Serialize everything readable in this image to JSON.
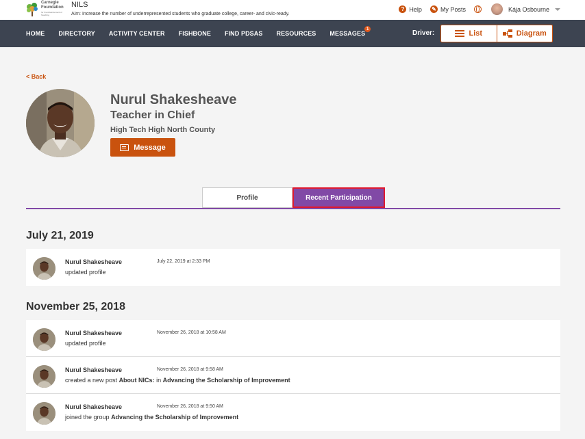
{
  "header": {
    "logo_line1": "Carnegie",
    "logo_line2": "Foundation",
    "logo_sub": "for the Advancement of Teaching",
    "app_name": "NILS",
    "aim": "Aim:  Increase the number of underrepresented students who graduate college, career- and civic-ready.",
    "help": "Help",
    "my_posts": "My Posts",
    "user_name": "Kája Osbourne"
  },
  "nav": {
    "items": [
      "HOME",
      "DIRECTORY",
      "ACTIVITY CENTER",
      "FISHBONE",
      "FIND PDSAS",
      "RESOURCES",
      "MESSAGES"
    ],
    "messages_badge": "1",
    "driver_label": "Driver:",
    "list_label": "List",
    "diagram_label": "Diagram"
  },
  "back": "< Back",
  "profile": {
    "name": "Nurul Shakesheave",
    "title": "Teacher in Chief",
    "school": "High Tech High North County",
    "message_button": "Message"
  },
  "tabs": {
    "profile": "Profile",
    "recent": "Recent Participation"
  },
  "groups": [
    {
      "date": "July 21, 2019",
      "activities": [
        {
          "name": "Nurul Shakesheave",
          "time": "July 22, 2019 at 2:33 PM",
          "text_plain": "updated profile",
          "bold1": "",
          "mid": "",
          "bold2": ""
        }
      ]
    },
    {
      "date": "November 25, 2018",
      "activities": [
        {
          "name": "Nurul Shakesheave",
          "time": "November 26, 2018 at 10:58 AM",
          "text_plain": "updated profile",
          "bold1": "",
          "mid": "",
          "bold2": ""
        },
        {
          "name": "Nurul Shakesheave",
          "time": "November 26, 2018 at 9:58 AM",
          "text_plain": "created a new post ",
          "bold1": "About NICs:",
          "mid": " in ",
          "bold2": "Advancing the Scholarship of Improvement"
        },
        {
          "name": "Nurul Shakesheave",
          "time": "November 26, 2018 at 9:50 AM",
          "text_plain": "joined the group ",
          "bold1": "Advancing the Scholarship of Improvement",
          "mid": "",
          "bold2": ""
        }
      ]
    }
  ]
}
